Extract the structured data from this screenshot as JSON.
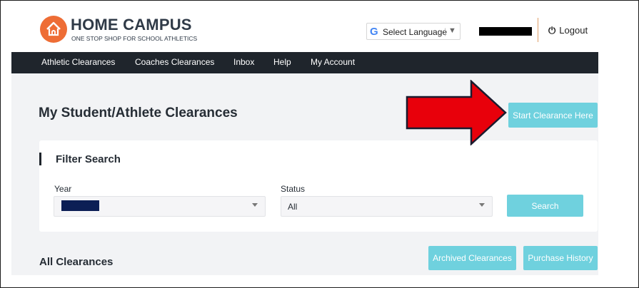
{
  "header": {
    "logo_title": "HOME CAMPUS",
    "logo_subtitle": "ONE STOP SHOP FOR SCHOOL ATHLETICS",
    "language_select": "Select Language",
    "logout_label": "Logout",
    "icons": [
      "home-icon",
      "google-icon",
      "power-icon"
    ]
  },
  "nav": {
    "items": [
      {
        "label": "Athletic Clearances"
      },
      {
        "label": "Coaches Clearances"
      },
      {
        "label": "Inbox"
      },
      {
        "label": "Help"
      },
      {
        "label": "My Account"
      }
    ]
  },
  "main": {
    "page_title": "My Student/Athlete Clearances",
    "start_button": "Start Clearance Here",
    "filter": {
      "title": "Filter Search",
      "year_label": "Year",
      "status_label": "Status",
      "status_value": "All",
      "search_button": "Search"
    },
    "all_clearances_title": "All Clearances",
    "archived_button": "Archived Clearances",
    "purchase_history_button": "Purchase History"
  },
  "colors": {
    "brand_orange": "#ee6d35",
    "nav_background": "#1f252c",
    "accent_button": "#6fd1de",
    "annotation_arrow": "#e8000b"
  }
}
